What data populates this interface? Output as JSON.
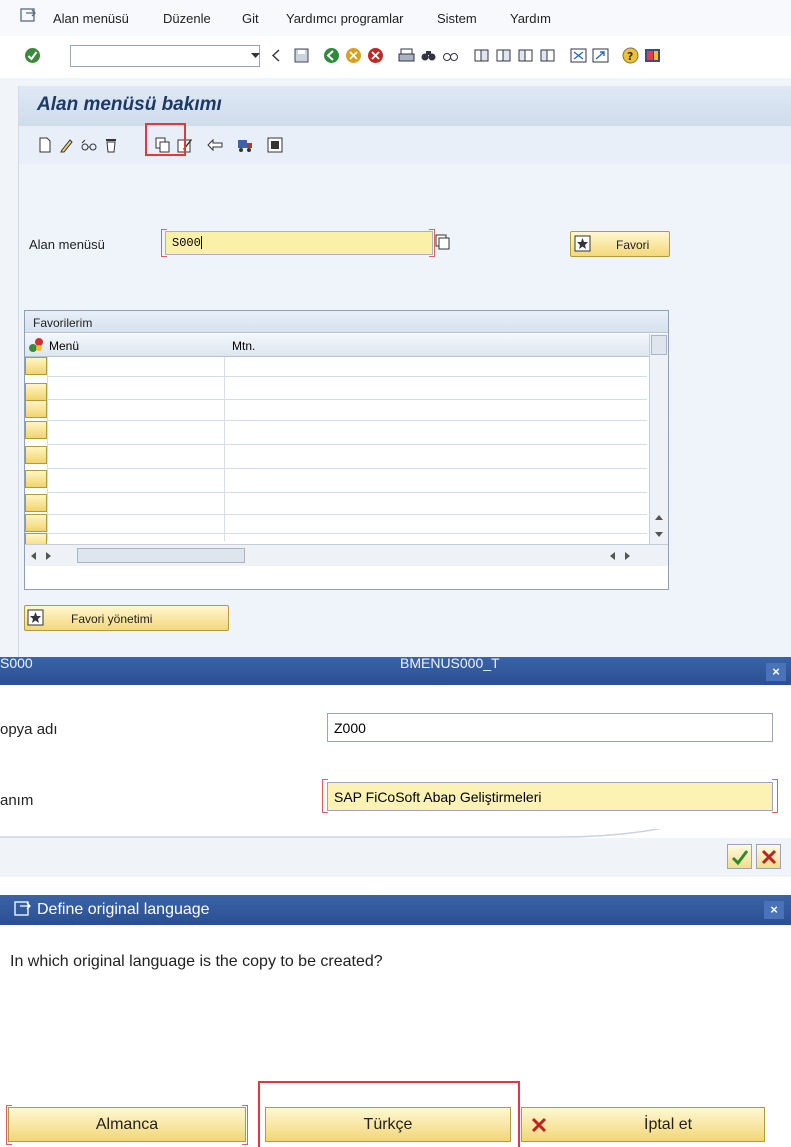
{
  "menubar": {
    "items": [
      "Alan menüsü",
      "Düzenle",
      "Git",
      "Yardımcı programlar",
      "Sistem",
      "Yardım"
    ]
  },
  "main": {
    "title": "Alan menüsü bakımı",
    "field_label": "Alan menüsü",
    "field_value": "S000",
    "favori_button": "Favori",
    "table": {
      "title": "Favorilerim",
      "columns": [
        "Menü",
        "Mtn."
      ],
      "row_count": 9
    },
    "favori_yonetimi_button": "Favori yönetimi"
  },
  "dialog_copy": {
    "title_left": "S000",
    "title_center": "BMENUS000_T",
    "copy_label": "opya adı",
    "copy_value": "Z000",
    "desc_label": "anım",
    "desc_value": "SAP FiCoSoft Abap Geliştirmeleri"
  },
  "dialog_language": {
    "title": "Define original language",
    "question": "In which original language is the copy to be created?",
    "buttons": {
      "almanca": "Almanca",
      "turkce": "Türkçe",
      "iptal": "İptal et"
    }
  },
  "colors": {
    "title_blue": "#1d3a66",
    "dialog_bar": "#2f5597",
    "input_yellow": "#fbf0a8",
    "highlight_red": "#e0393e"
  }
}
